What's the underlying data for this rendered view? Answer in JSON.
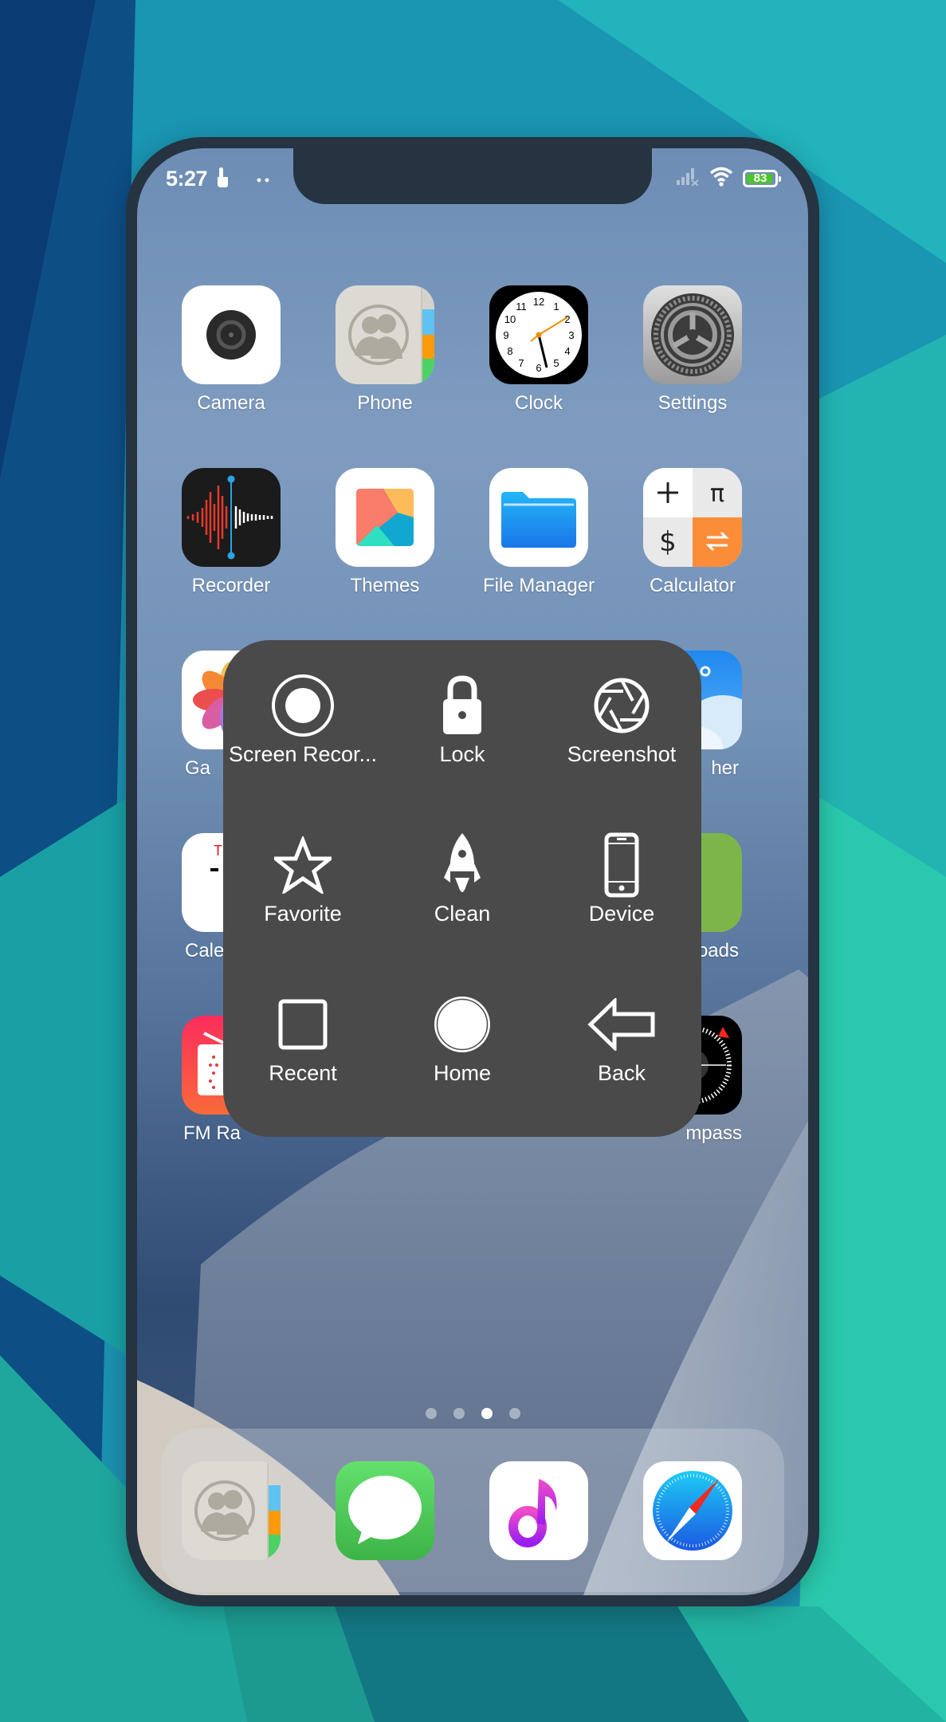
{
  "status_bar": {
    "time": "5:27",
    "battery_percent": "83",
    "icons": [
      "touch-icon",
      "dots-icon",
      "signal-icon",
      "wifi-icon",
      "battery-icon"
    ]
  },
  "home_apps": [
    {
      "label": "Camera",
      "icon": "camera-icon"
    },
    {
      "label": "Phone",
      "icon": "contacts-icon"
    },
    {
      "label": "Clock",
      "icon": "clock-icon"
    },
    {
      "label": "Settings",
      "icon": "gear-icon"
    },
    {
      "label": "Recorder",
      "icon": "waveform-icon"
    },
    {
      "label": "Themes",
      "icon": "themes-icon"
    },
    {
      "label": "File Manager",
      "icon": "folder-icon"
    },
    {
      "label": "Calculator",
      "icon": "calculator-icon"
    },
    {
      "label": "Ga",
      "icon": "gallery-icon"
    },
    {
      "label": "her",
      "icon": "weather-icon"
    },
    {
      "label": "Cale",
      "icon": "calendar-icon"
    },
    {
      "label": "oads",
      "icon": "downloads-icon"
    },
    {
      "label": "FM Ra",
      "icon": "radio-icon"
    },
    {
      "label": "mpass",
      "icon": "compass-icon"
    }
  ],
  "assistive_menu": {
    "items": [
      {
        "label": "Screen Recor...",
        "icon": "record-icon"
      },
      {
        "label": "Lock",
        "icon": "lock-icon"
      },
      {
        "label": "Screenshot",
        "icon": "aperture-icon"
      },
      {
        "label": "Favorite",
        "icon": "star-icon"
      },
      {
        "label": "Clean",
        "icon": "rocket-icon"
      },
      {
        "label": "Device",
        "icon": "phone-device-icon"
      },
      {
        "label": "Recent",
        "icon": "square-icon"
      },
      {
        "label": "Home",
        "icon": "home-circle-icon"
      },
      {
        "label": "Back",
        "icon": "back-arrow-icon"
      }
    ]
  },
  "page_indicator": {
    "total": 4,
    "active": 3
  },
  "dock": [
    {
      "name": "Contacts",
      "icon": "contacts-icon"
    },
    {
      "name": "Messages",
      "icon": "message-icon"
    },
    {
      "name": "Music",
      "icon": "music-note-icon"
    },
    {
      "name": "Browser",
      "icon": "compass-browser-icon"
    }
  ]
}
